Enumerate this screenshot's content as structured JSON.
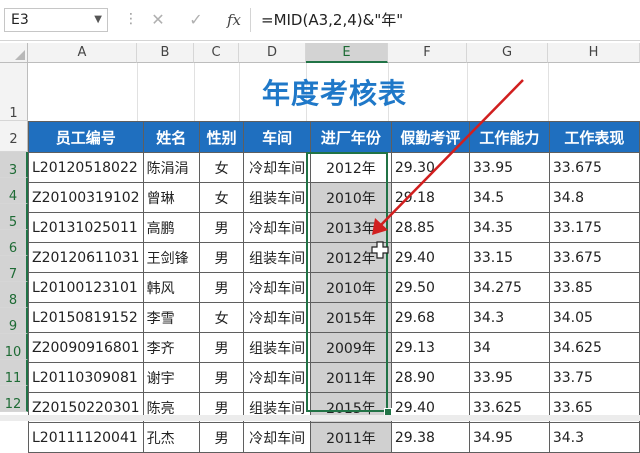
{
  "formula_bar": {
    "name_box": "E3",
    "separator": "⋮",
    "cancel_icon": "✕",
    "enter_icon": "✓",
    "fx_label": "fx",
    "formula": "=MID(A3,2,4)&\"年\""
  },
  "columns": [
    "A",
    "B",
    "C",
    "D",
    "E",
    "F",
    "G",
    "H"
  ],
  "selected_column": "E",
  "rows": [
    "1",
    "2",
    "3",
    "4",
    "5",
    "6",
    "7",
    "8",
    "9",
    "10",
    "11",
    "12"
  ],
  "sheet": {
    "title": "年度考核表",
    "headers": [
      "员工编号",
      "姓名",
      "性别",
      "车间",
      "进厂年份",
      "假勤考评",
      "工作能力",
      "工作表现"
    ],
    "records": [
      [
        "L20120518022",
        "陈涓涓",
        "女",
        "冷却车间",
        "2012年",
        "29.30",
        "33.95",
        "33.675"
      ],
      [
        "Z20100319102",
        "曾琳",
        "女",
        "组装车间",
        "2010年",
        "29.18",
        "34.5",
        "34.8"
      ],
      [
        "L20131025011",
        "高鹏",
        "男",
        "冷却车间",
        "2013年",
        "28.85",
        "34.35",
        "33.175"
      ],
      [
        "Z20120611031",
        "王剑锋",
        "男",
        "组装车间",
        "2012年",
        "29.40",
        "33.15",
        "33.675"
      ],
      [
        "L20100123101",
        "韩风",
        "男",
        "冷却车间",
        "2010年",
        "29.50",
        "34.275",
        "33.85"
      ],
      [
        "L20150819152",
        "李雪",
        "女",
        "冷却车间",
        "2015年",
        "29.68",
        "34.3",
        "34.05"
      ],
      [
        "Z20090916801",
        "李齐",
        "男",
        "组装车间",
        "2009年",
        "29.13",
        "34",
        "34.625"
      ],
      [
        "L20110309081",
        "谢宇",
        "男",
        "冷却车间",
        "2011年",
        "28.90",
        "33.95",
        "33.75"
      ],
      [
        "Z20150220301",
        "陈亮",
        "男",
        "组装车间",
        "2015年",
        "29.40",
        "33.625",
        "33.65"
      ],
      [
        "L20111120041",
        "孔杰",
        "男",
        "冷却车间",
        "2011年",
        "29.38",
        "34.95",
        "34.3"
      ]
    ]
  },
  "colors": {
    "title": "#1f78c8",
    "header_fill": "#1f6fbf",
    "selection": "#217346",
    "arrow": "#d11f1f"
  }
}
